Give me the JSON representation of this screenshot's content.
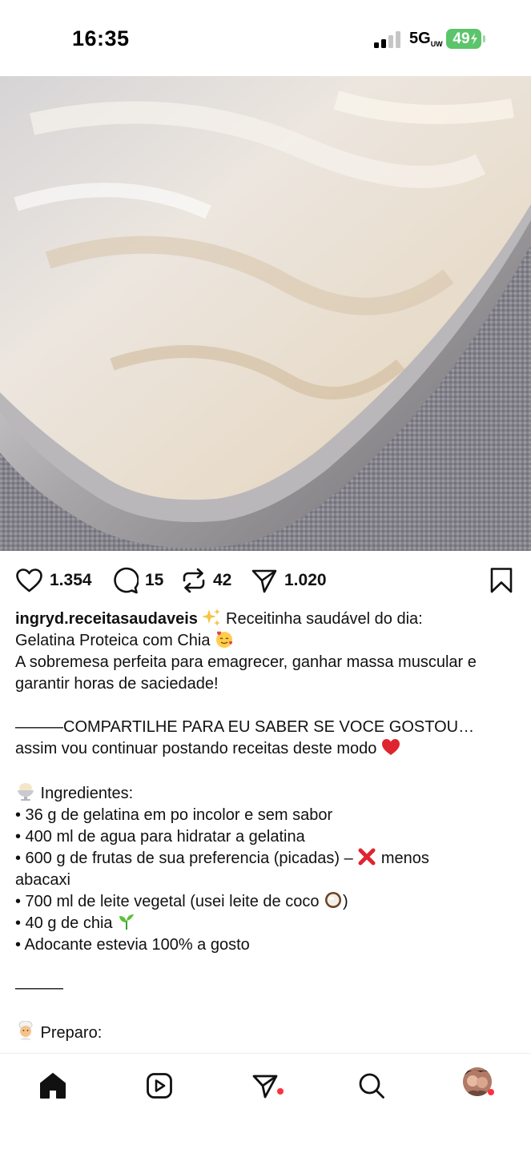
{
  "status_bar": {
    "time": "16:35",
    "network": "5G",
    "network_sub": "UW",
    "battery": "49",
    "battery_color": "#5cc46a"
  },
  "media": {
    "type": "video",
    "icons": [
      "speaker-icon"
    ]
  },
  "actions": {
    "likes": "1.354",
    "comments": "15",
    "reposts": "42",
    "shares": "1.020",
    "icons": [
      "heart-icon",
      "comment-icon",
      "repost-icon",
      "send-icon",
      "bookmark-icon"
    ]
  },
  "caption": {
    "username": "ingryd.receitasaudaveis",
    "line1_rest": " Receitinha saudável do dia:",
    "line2": "Gelatina Proteica com Chia",
    "line3": "A sobremesa perfeita para emagrecer, ganhar massa muscular e",
    "line4": "garantir horas de saciedade!",
    "line5": "———COMPARTILHE PARA EU SABER SE VOCE GOSTOU…",
    "line6": "assim vou continuar postando receitas deste modo",
    "ingredients_title": " Ingredientes:",
    "ingredients": [
      "• 36 g de gelatina em po incolor e sem sabor",
      "• 400 ml de agua para hidratar a gelatina",
      "• 600 g de frutas de sua preferencia (picadas) – ",
      "abacaxi",
      "• 700 ml de leite vegetal (usei leite de coco ",
      "• 40 g de chia ",
      "• Adocante estevia 100% a gosto"
    ],
    "ingredient3_tail": " menos",
    "ingredient5_tail": ")",
    "separator": "———",
    "preparo_title": " Preparo:"
  },
  "bottom_nav": {
    "items": [
      "home-icon",
      "reels-icon",
      "messages-icon",
      "search-icon",
      "profile-avatar"
    ],
    "notification_color": "#ff3040"
  }
}
